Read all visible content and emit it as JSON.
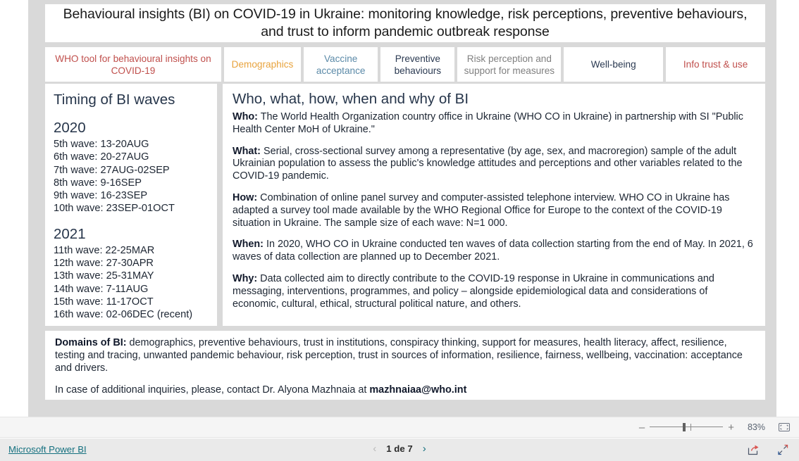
{
  "report": {
    "title": "Behavioural insights (BI) on COVID-19 in Ukraine: monitoring knowledge, risk perceptions, preventive behaviours, and trust to inform pandemic outbreak response"
  },
  "tabs": [
    {
      "label": "WHO tool for behavioural insights on COVID-19",
      "color": "#c0504d"
    },
    {
      "label": "Demographics",
      "color": "#e8a33d"
    },
    {
      "label": "Vaccine acceptance",
      "color": "#5b8aa8"
    },
    {
      "label": "Preventive behaviours",
      "color": "#2b3a52"
    },
    {
      "label": "Risk perception and support for measures",
      "color": "#808080"
    },
    {
      "label": "Well-being",
      "color": "#2b3a52"
    },
    {
      "label": "Info trust & use",
      "color": "#c0504d"
    }
  ],
  "left_panel": {
    "heading": "Timing of BI waves",
    "years": [
      {
        "year": "2020",
        "waves": [
          "5th wave: 13-20AUG",
          "6th wave: 20-27AUG",
          "7th wave: 27AUG-02SEP",
          "8th wave: 9-16SEP",
          "9th wave: 16-23SEP",
          "10th wave: 23SEP-01OCT"
        ]
      },
      {
        "year": "2021",
        "waves": [
          "11th wave: 22-25MAR",
          "12th wave: 27-30APR",
          "13th wave: 25-31MAY",
          "14th wave: 7-11AUG",
          "15th wave: 11-17OCT",
          "16th wave:  02-06DEC (recent)"
        ]
      }
    ]
  },
  "right_panel": {
    "heading": "Who, what, how, when and why of BI",
    "paragraphs": [
      {
        "label": "Who:",
        "text": " The World Health Organization country office in Ukraine (WHO CO in Ukraine) in partnership with SI \"Public Health Center MoH of Ukraine.\""
      },
      {
        "label": "What:",
        "text": " Serial, cross-sectional survey among a representative (by age, sex, and macroregion) sample of the adult Ukrainian population to assess the public's knowledge attitudes and perceptions and other variables related to the COVID-19 pandemic."
      },
      {
        "label": "How:",
        "text": " Combination of online panel survey and computer-assisted telephone interview. WHO CO in Ukraine has adapted a survey tool made available by the WHO Regional Office for Europe to the context of the COVID-19 situation in Ukraine. The sample size of each wave: N=1 000."
      },
      {
        "label": "When:",
        "text": " In 2020, WHO CO in Ukraine conducted ten waves of data collection starting from the end of May. In 2021, 6 waves of data collection are planned up to December 2021."
      },
      {
        "label": "Why:",
        "text": " Data collected aim to directly contribute to the COVID-19 response in Ukraine in communications and messaging, interventions, programmes, and policy – alongside epidemiological data and considerations of economic, cultural, ethical, structural political nature, and others."
      }
    ]
  },
  "footer_panel": {
    "domains_label": "Domains of BI:",
    "domains_text": " demographics, preventive behaviours, trust in institutions, conspiracy thinking, support for measures, health literacy, affect, resilience, testing and tracing, unwanted pandemic behaviour, risk perception, trust in sources of information, resilience, fairness, wellbeing, vaccination: acceptance and drivers.",
    "contact_text": "In case of additional inquiries, please, contact Dr. Alyona Mazhnaia at ",
    "contact_email": "mazhnaiaa@who.int"
  },
  "zoombar": {
    "minus_label": "–",
    "plus_label": "+",
    "zoom_value": "83%",
    "fit_icon": "fit-to-page-icon"
  },
  "statusbar": {
    "brand": "Microsoft Power BI",
    "page_label": "1 de 7",
    "prev_label": "‹",
    "next_label": "›",
    "share_icon": "share-icon",
    "fullscreen_icon": "fullscreen-icon"
  }
}
